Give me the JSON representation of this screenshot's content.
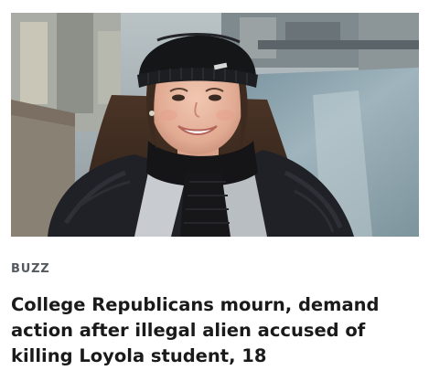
{
  "article": {
    "category": "BUZZ",
    "headline": "College Republicans mourn, demand action after illegal alien accused of killing Loyola student, 18",
    "image_alt": "Young woman in a black knit beanie and scarf smiling by a river"
  }
}
